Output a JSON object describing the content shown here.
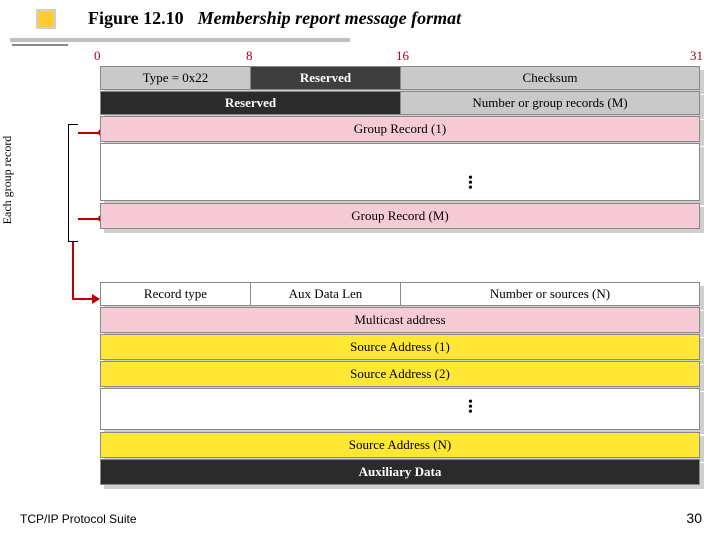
{
  "title": {
    "fig": "Figure 12.10",
    "text": "Membership report message format"
  },
  "ticks": {
    "t0": "0",
    "t8": "8",
    "t16": "16",
    "t31": "31"
  },
  "side_label": "Each group record",
  "msg": {
    "row1": {
      "type": "Type = 0x22",
      "reserved": "Reserved",
      "checksum": "Checksum"
    },
    "row2": {
      "reserved": "Reserved",
      "count": "Number or group records (M)"
    },
    "gr1": "Group Record (1)",
    "grM": "Group Record (M)"
  },
  "rec": {
    "row1": {
      "type": "Record type",
      "aux": "Aux Data Len",
      "count": "Number or sources (N)"
    },
    "mcast": "Multicast address",
    "src1": "Source Address (1)",
    "src2": "Source Address (2)",
    "srcN": "Source Address (N)",
    "aux": "Auxiliary Data"
  },
  "footer": {
    "left": "TCP/IP Protocol Suite",
    "page": "30"
  }
}
